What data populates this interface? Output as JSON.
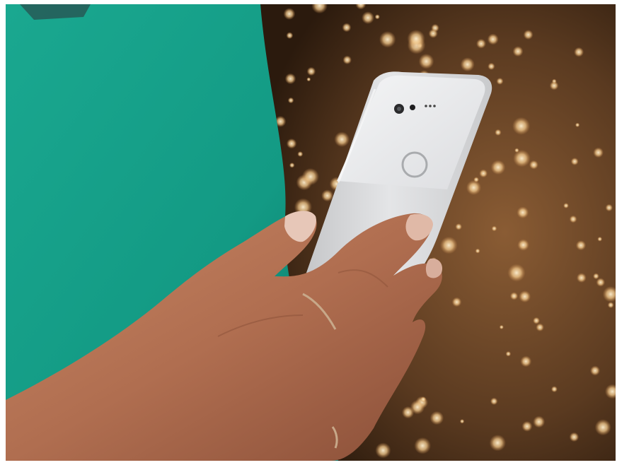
{
  "photo": {
    "subject": "hand-holding-smartphone",
    "colors": {
      "shirt_teal": "#17a08a",
      "shirt_shadow": "#0b7466",
      "sequin_dark": "#3a2413",
      "sequin_mid": "#7a5230",
      "sequin_glow": "#f3c98c",
      "skin": "#b9785a",
      "skin_shadow": "#8a4f38",
      "nail": "#e7c7b8",
      "phone_body": "#d9dadc",
      "phone_glass": "#eeeff0",
      "ring": "#c7a889"
    },
    "icons": [
      "camera-lens-icon",
      "fingerprint-sensor-icon",
      "flash-icon"
    ]
  }
}
